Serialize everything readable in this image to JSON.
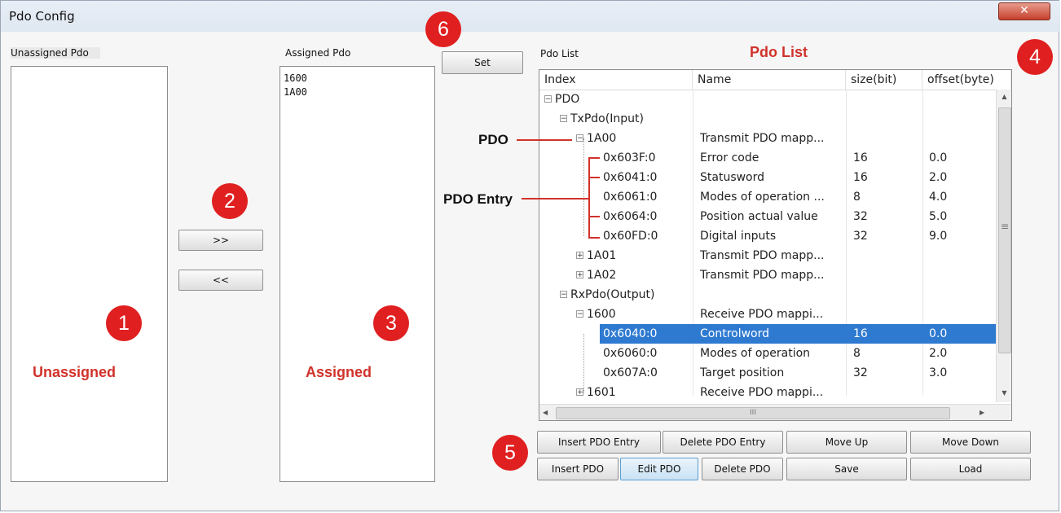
{
  "window": {
    "title": "Pdo Config",
    "close_glyph": "✕"
  },
  "left_panel": {
    "label": "Unassigned Pdo",
    "items": []
  },
  "middle_panel": {
    "label": "Assigned Pdo",
    "items": [
      "1600",
      "1A00"
    ]
  },
  "transfer_buttons": {
    "add": ">>",
    "remove": "<<"
  },
  "set_button": "Set",
  "pdo_list": {
    "label": "Pdo List",
    "columns": [
      "Index",
      "Name",
      "size(bit)",
      "offset(byte)"
    ],
    "rows": [
      {
        "index": "PDO",
        "name": "",
        "size": "",
        "offset": ""
      },
      {
        "index": "TxPdo(Input)",
        "name": "",
        "size": "",
        "offset": ""
      },
      {
        "index": "1A00",
        "name": "Transmit PDO mapp...",
        "size": "",
        "offset": ""
      },
      {
        "index": "0x603F:0",
        "name": "Error code",
        "size": "16",
        "offset": "0.0"
      },
      {
        "index": "0x6041:0",
        "name": "Statusword",
        "size": "16",
        "offset": "2.0"
      },
      {
        "index": "0x6061:0",
        "name": "Modes of operation ...",
        "size": "8",
        "offset": "4.0"
      },
      {
        "index": "0x6064:0",
        "name": "Position actual value",
        "size": "32",
        "offset": "5.0"
      },
      {
        "index": "0x60FD:0",
        "name": "Digital inputs",
        "size": "32",
        "offset": "9.0"
      },
      {
        "index": "1A01",
        "name": "Transmit PDO mapp...",
        "size": "",
        "offset": ""
      },
      {
        "index": "1A02",
        "name": "Transmit PDO mapp...",
        "size": "",
        "offset": ""
      },
      {
        "index": "RxPdo(Output)",
        "name": "",
        "size": "",
        "offset": ""
      },
      {
        "index": "1600",
        "name": "Receive PDO mappi...",
        "size": "",
        "offset": ""
      },
      {
        "index": "0x6040:0",
        "name": "Controlword",
        "size": "16",
        "offset": "0.0"
      },
      {
        "index": "0x6060:0",
        "name": "Modes of operation",
        "size": "8",
        "offset": "2.0"
      },
      {
        "index": "0x607A:0",
        "name": "Target position",
        "size": "32",
        "offset": "3.0"
      },
      {
        "index": "1601",
        "name": "Receive PDO mappi...",
        "size": "",
        "offset": ""
      }
    ],
    "selected_row": "0x6040:0",
    "scroll_glyphs": {
      "up": "▲",
      "down": "▼",
      "left": "◀",
      "right": "▶",
      "grip_v": "≡",
      "grip_h": "III"
    }
  },
  "action_buttons": {
    "insert_entry": "Insert PDO Entry",
    "delete_entry": "Delete PDO Entry",
    "move_up": "Move Up",
    "move_down": "Move Down",
    "insert_pdo": "Insert PDO",
    "edit_pdo": "Edit PDO",
    "delete_pdo": "Delete PDO",
    "save": "Save",
    "load": "Load"
  },
  "annotations": {
    "badges": [
      "1",
      "2",
      "3",
      "4",
      "5",
      "6"
    ],
    "unassigned": "Unassigned",
    "assigned": "Assigned",
    "pdo_list_title": "Pdo List",
    "pdo": "PDO",
    "pdo_entry": "PDO Entry"
  },
  "colors": {
    "annotation_red": "#d1322b",
    "badge_red": "#e02020",
    "selection_blue": "#2e7ad1"
  }
}
